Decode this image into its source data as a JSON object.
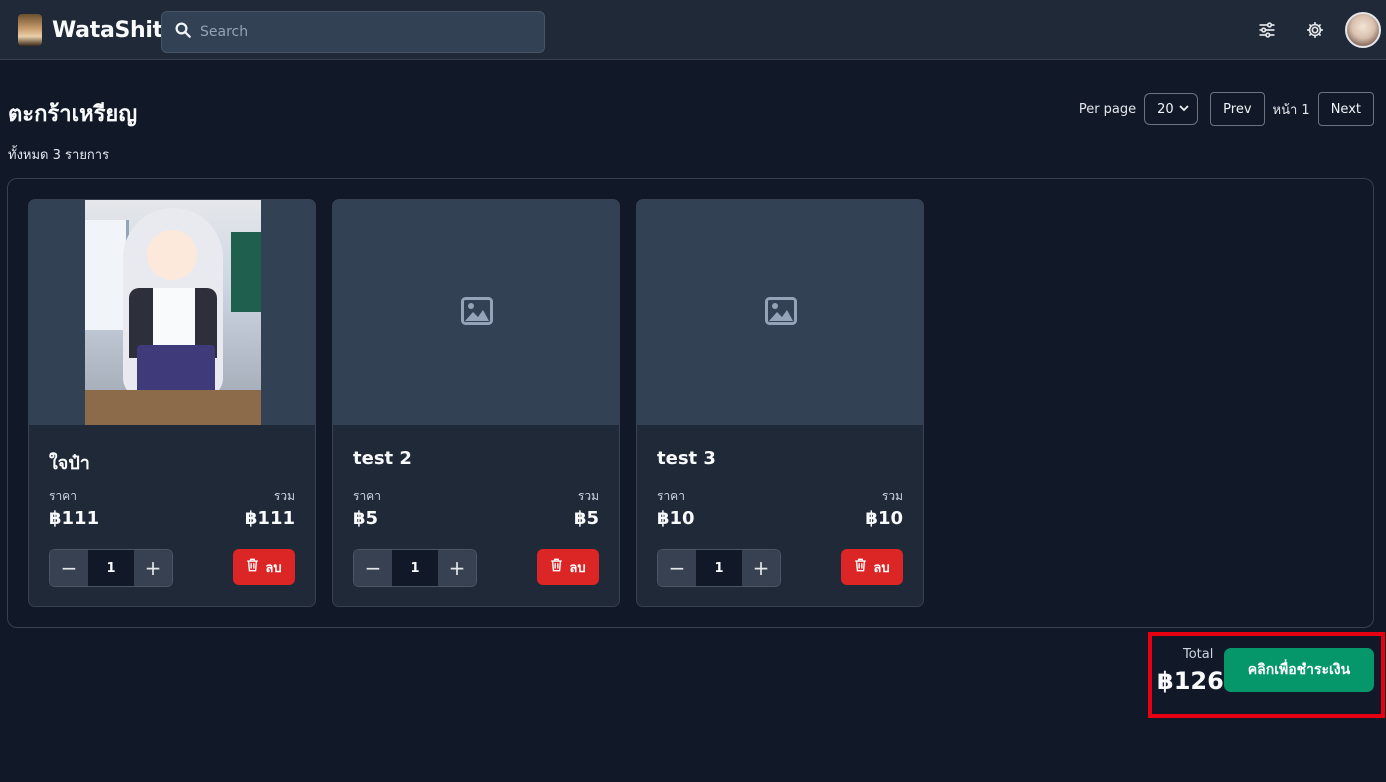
{
  "app": {
    "name": "WataShit"
  },
  "search": {
    "placeholder": "Search"
  },
  "page": {
    "title": "ตะกร้าเหรียญ",
    "item_count_text": "ทั้งหมด 3 รายการ"
  },
  "pager": {
    "per_page_label": "Per page",
    "per_page_value": "20",
    "prev_label": "Prev",
    "page_text": "หน้า 1",
    "next_label": "Next"
  },
  "cart": {
    "items": [
      {
        "title": "ใจป๋า",
        "price_label": "ราคา",
        "price": "฿111",
        "sum_label": "รวม",
        "sum": "฿111",
        "qty": "1",
        "delete_label": "ลบ",
        "has_image": true
      },
      {
        "title": "test 2",
        "price_label": "ราคา",
        "price": "฿5",
        "sum_label": "รวม",
        "sum": "฿5",
        "qty": "1",
        "delete_label": "ลบ",
        "has_image": false
      },
      {
        "title": "test 3",
        "price_label": "ราคา",
        "price": "฿10",
        "sum_label": "รวม",
        "sum": "฿10",
        "qty": "1",
        "delete_label": "ลบ",
        "has_image": false
      }
    ]
  },
  "checkout": {
    "total_label": "Total",
    "total_value": "฿126",
    "pay_label": "คลิกเพื่อชำระเงิน"
  },
  "icons": {
    "search": "search-icon",
    "filters": "sliders-icon",
    "settings": "gear-icon",
    "placeholder": "image-placeholder-icon",
    "minus": "minus-icon",
    "plus": "plus-icon",
    "delete": "trash-icon"
  },
  "colors": {
    "background": "#111827",
    "surface": "#1f2937",
    "danger": "#dc2626",
    "success": "#059669",
    "highlight": "#e60012"
  }
}
